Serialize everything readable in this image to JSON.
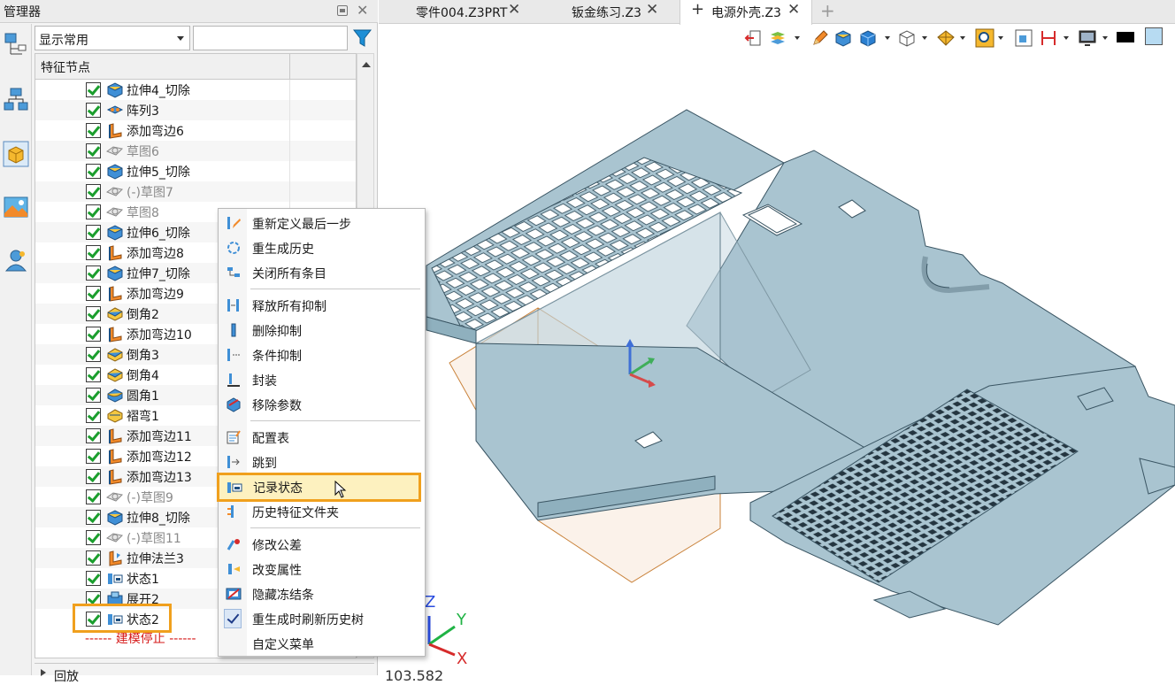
{
  "manager": {
    "title": "管理器",
    "display_filter": "显示常用",
    "filter_value": "",
    "column_header": "特征节点",
    "bottom_section": "回放"
  },
  "tree_items": [
    {
      "label": "拉伸4_切除",
      "icon": "extrude-cut-icon",
      "dim": false
    },
    {
      "label": "阵列3",
      "icon": "pattern-icon",
      "dim": false
    },
    {
      "label": "添加弯边6",
      "icon": "flange-icon",
      "dim": false
    },
    {
      "label": "草图6",
      "icon": "sketch-icon",
      "dim": true
    },
    {
      "label": "拉伸5_切除",
      "icon": "extrude-cut-icon",
      "dim": false
    },
    {
      "label": "(-)草图7",
      "icon": "sketch-icon",
      "dim": true
    },
    {
      "label": "草图8",
      "icon": "sketch-icon",
      "dim": true
    },
    {
      "label": "拉伸6_切除",
      "icon": "extrude-cut-icon",
      "dim": false
    },
    {
      "label": "添加弯边8",
      "icon": "flange-icon",
      "dim": false
    },
    {
      "label": "拉伸7_切除",
      "icon": "extrude-cut-icon",
      "dim": false
    },
    {
      "label": "添加弯边9",
      "icon": "flange-icon",
      "dim": false
    },
    {
      "label": "倒角2",
      "icon": "chamfer-icon",
      "dim": false
    },
    {
      "label": "添加弯边10",
      "icon": "flange-icon",
      "dim": false
    },
    {
      "label": "倒角3",
      "icon": "chamfer-icon",
      "dim": false
    },
    {
      "label": "倒角4",
      "icon": "chamfer-icon",
      "dim": false
    },
    {
      "label": "圆角1",
      "icon": "fillet-icon",
      "dim": false
    },
    {
      "label": "褶弯1",
      "icon": "hem-icon",
      "dim": false
    },
    {
      "label": "添加弯边11",
      "icon": "flange-icon",
      "dim": false
    },
    {
      "label": "添加弯边12",
      "icon": "flange-icon",
      "dim": false
    },
    {
      "label": "添加弯边13",
      "icon": "flange-icon",
      "dim": false
    },
    {
      "label": "(-)草图9",
      "icon": "sketch-icon",
      "dim": true
    },
    {
      "label": "拉伸8_切除",
      "icon": "extrude-cut-icon",
      "dim": false
    },
    {
      "label": "(-)草图11",
      "icon": "sketch-icon",
      "dim": true
    },
    {
      "label": "拉伸法兰3",
      "icon": "extrude-flange-icon",
      "dim": false
    },
    {
      "label": "状态1",
      "icon": "state-icon",
      "dim": false
    },
    {
      "label": "展开2",
      "icon": "unfold-icon",
      "dim": false
    },
    {
      "label": "状态2",
      "icon": "state-icon",
      "dim": false
    }
  ],
  "build_stop": "------ 建模停止 ------",
  "tabs": [
    {
      "label": "零件004.Z3PRT",
      "active": false
    },
    {
      "label": "钣金练习.Z3",
      "active": false
    },
    {
      "label": "电源外壳.Z3",
      "active": true
    }
  ],
  "context_menu": {
    "groups": [
      [
        {
          "label": "重新定义最后一步",
          "icon": "redefine-icon"
        },
        {
          "label": "重生成历史",
          "icon": "regen-icon"
        },
        {
          "label": "关闭所有条目",
          "icon": "collapse-icon"
        }
      ],
      [
        {
          "label": "释放所有抑制",
          "icon": "unsuppress-icon"
        },
        {
          "label": "删除抑制",
          "icon": "delete-suppress-icon"
        },
        {
          "label": "条件抑制",
          "icon": "conditional-suppress-icon"
        },
        {
          "label": "封装",
          "icon": "encapsulate-icon"
        },
        {
          "label": "移除参数",
          "icon": "remove-params-icon"
        }
      ],
      [
        {
          "label": "配置表",
          "icon": "config-table-icon"
        },
        {
          "label": "跳到",
          "icon": "jump-icon"
        },
        {
          "label": "记录状态",
          "icon": "record-state-icon",
          "highlight": true
        },
        {
          "label": "历史特征文件夹",
          "icon": "history-folder-icon"
        }
      ],
      [
        {
          "label": "修改公差",
          "icon": "tolerance-icon"
        },
        {
          "label": "改变属性",
          "icon": "attributes-icon"
        },
        {
          "label": "隐藏冻结条",
          "icon": "hide-freeze-icon"
        },
        {
          "label": "重生成时刷新历史树",
          "icon": "check-icon",
          "checked": true
        },
        {
          "label": "自定义菜单",
          "icon": "none"
        }
      ]
    ]
  },
  "viewport": {
    "coordinate_readout": "103.582",
    "axes": {
      "x": "X",
      "y": "Y",
      "z": "Z"
    }
  },
  "colors": {
    "highlight_border": "#f0a01d",
    "highlight_fill": "#fdf1bf",
    "part_fill": "#a9c4d0",
    "part_edge": "#3a5563",
    "plane_edge": "#c9823a",
    "check_green": "#1b9e2d",
    "stop_red": "#d61b1b"
  }
}
